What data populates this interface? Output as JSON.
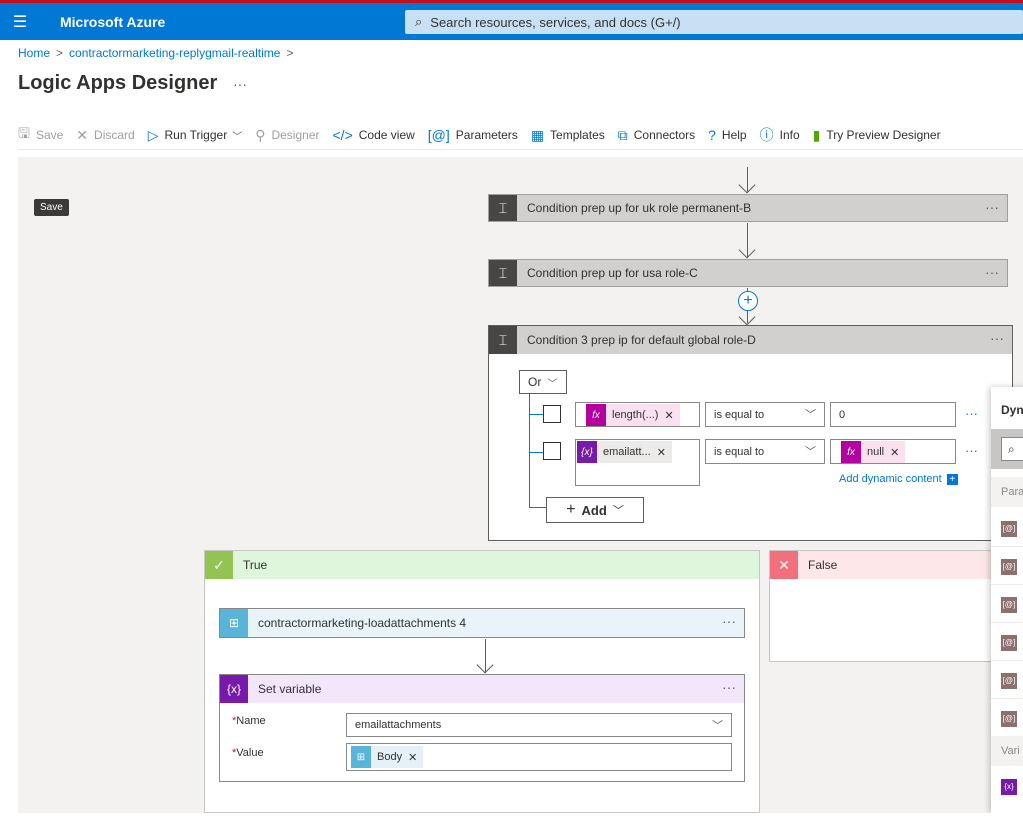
{
  "app": {
    "menu_icon": "hamburger-icon",
    "brand": "Microsoft Azure",
    "search_placeholder": "Search resources, services, and docs (G+/)"
  },
  "breadcrumb": {
    "home": "Home",
    "resource": "contractormarketing-replygmail-realtime"
  },
  "page": {
    "title": "Logic Apps Designer",
    "more": "···"
  },
  "toolbar": {
    "save": "Save",
    "discard": "Discard",
    "run_trigger": "Run Trigger",
    "designer": "Designer",
    "code_view": "Code view",
    "parameters": "Parameters",
    "templates": "Templates",
    "connectors": "Connectors",
    "help": "Help",
    "info": "Info",
    "try_preview": "Try Preview Designer"
  },
  "canvas": {
    "tooltip": "Save",
    "conditions": [
      {
        "label": "Condition prep up for uk role permanent-B"
      },
      {
        "label": "Condition prep up for usa role-C"
      }
    ],
    "condition_open": {
      "label": "Condition 3 prep ip for default global role-D",
      "group_operator": "Or",
      "rows": [
        {
          "token": "length(...)",
          "operator": "is equal to",
          "value": "0"
        },
        {
          "token": "emailatt...",
          "operator": "is equal to",
          "value_token": "null"
        }
      ],
      "add_dynamic": "Add dynamic content",
      "add_button": "Add"
    },
    "true_branch": {
      "label": "True",
      "actions": [
        {
          "label": "contractormarketing-loadattachments 4"
        },
        {
          "label": "Set variable",
          "name_label": "Name",
          "name_value": "emailattachments",
          "value_label": "Value",
          "value_token": "Body"
        }
      ]
    },
    "false_branch": {
      "label": "False"
    }
  },
  "dynamic_panel": {
    "title": "Dyn",
    "section_params": "Para",
    "section_vars": "Vari"
  },
  "colors": {
    "azure_blue": "#0078d4",
    "true_green": "#92c353",
    "false_red": "#f1707b",
    "variable_purple": "#7719aa",
    "expression_magenta": "#b4009e"
  }
}
